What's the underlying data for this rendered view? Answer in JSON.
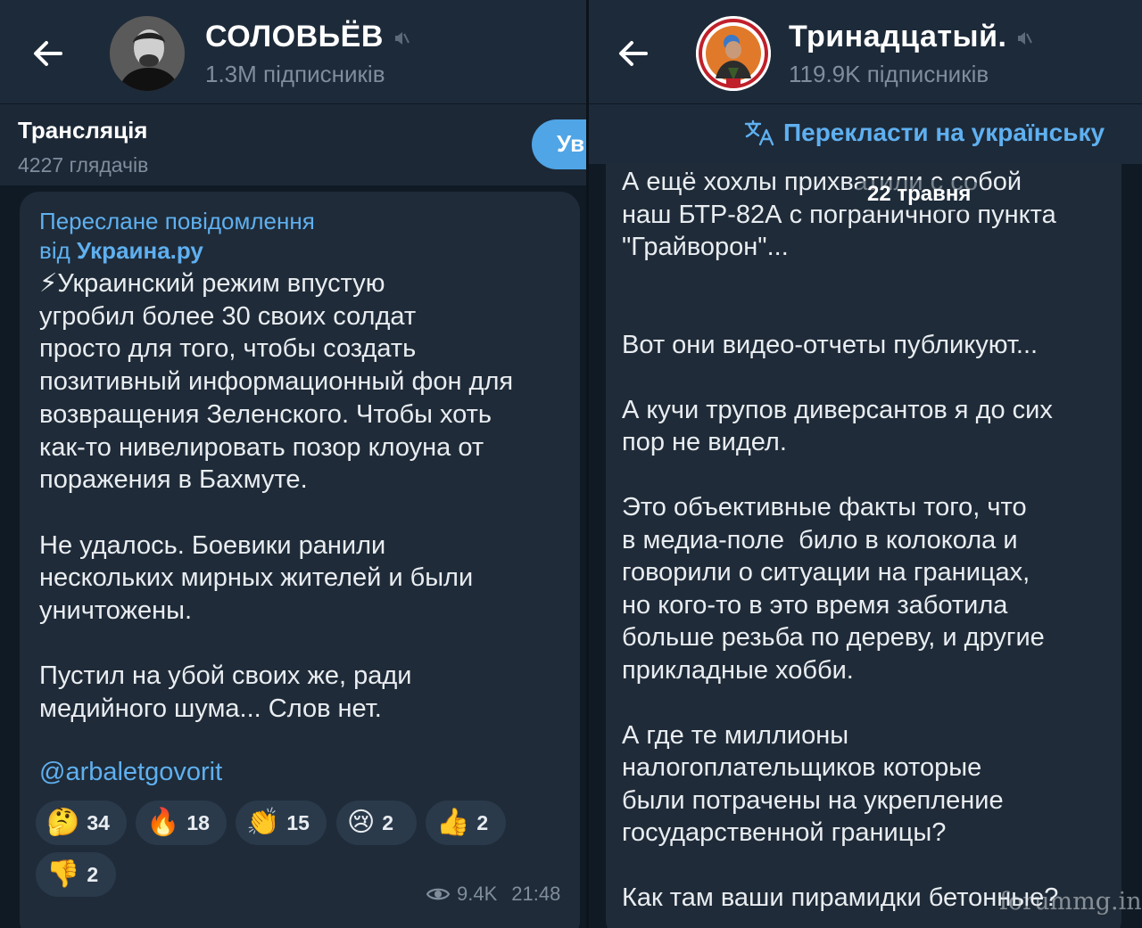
{
  "left": {
    "channel": {
      "name": "СОЛОВЬЁВ",
      "subscribers": "1.3M підписників"
    },
    "live": {
      "title": "Трансляція",
      "viewers": "4227 глядачів",
      "join_label": "Ув"
    },
    "message": {
      "forward_line1": "Переслане повідомлення",
      "forward_prefix": "від ",
      "forward_source": "Украина.ру",
      "text": "⚡Украинский режим впустую\nугробил более 30 своих солдат\nпросто для того, чтобы создать\nпозитивный информационный фон для\nвозвращения Зеленского. Чтобы хоть\nкак-то нивелировать позор клоуна от\nпоражения в Бахмуте.\n\nНе удалось. Боевики ранили\nнескольких мирных жителей и были\nуничтожены.\n\nПустил на убой своих же, ради\nмедийного шума... Слов нет.",
      "mention": "@arbaletgovorit",
      "reactions": [
        {
          "emoji": "🤔",
          "count": "34"
        },
        {
          "emoji": "🔥",
          "count": "18"
        },
        {
          "emoji": "👏",
          "count": "15"
        },
        {
          "emoji": "😢",
          "count": "2"
        },
        {
          "emoji": "👍",
          "count": "2"
        },
        {
          "emoji": "👎",
          "count": "2"
        }
      ],
      "views": "9.4K",
      "time": "21:48"
    }
  },
  "right": {
    "channel": {
      "name": "Тринадцатый.",
      "subscribers": "119.9K підписників"
    },
    "translate_label": "Перекласти на українську",
    "date_pill": "22 травня",
    "message": {
      "text": "А ещё хохлы прихватили с собой\nнаш БТР-82А с пограничного пункта\n\"Грайворон\"...\n\n\nВот они видео-отчеты публикуют...\n\nА кучи трупов диверсантов я до сих\nпор не видел.\n\nЭто объективные факты того, что\nв медиа-поле  било в колокола и\nговорили о ситуации на границах,\nно кого-то в это время заботила\nбольше резьба по дереву, и другие\nприкладные хобби.\n\nА где те миллионы\nналогоплательщиков которые\nбыли потрачены на укрепление\nгосударственной границы?\n\nКак там ваши пирамидки бетонные?"
    }
  },
  "watermark": "forummg.info"
}
